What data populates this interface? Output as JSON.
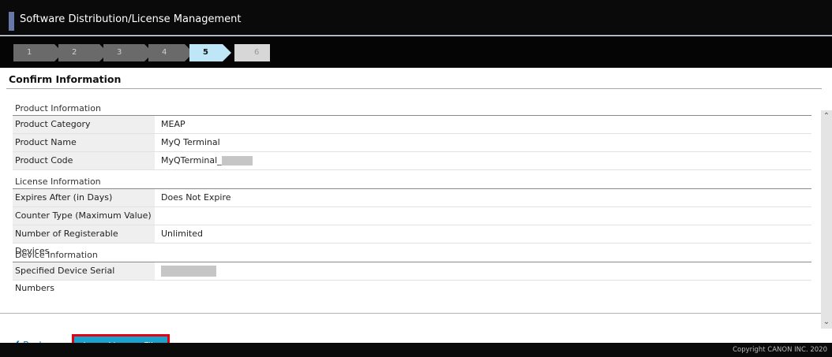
{
  "header": {
    "title": "Software Distribution/License Management"
  },
  "steps": [
    {
      "label": "1"
    },
    {
      "label": "2"
    },
    {
      "label": "3"
    },
    {
      "label": "4"
    },
    {
      "label": "5"
    },
    {
      "label": "6"
    }
  ],
  "page": {
    "section_title": "Confirm Information"
  },
  "product": {
    "heading": "Product Information",
    "category_label": "Product Category",
    "category_value": "MEAP",
    "name_label": "Product Name",
    "name_value": "MyQ Terminal",
    "code_label": "Product Code",
    "code_value": "MyQTerminal_"
  },
  "license": {
    "heading": "License Information",
    "expires_label": "Expires After (in Days)",
    "expires_value": "Does Not Expire",
    "counter_label": "Counter Type (Maximum Value)",
    "counter_value": "",
    "devices_label": "Number of Registerable Devices",
    "devices_value": "Unlimited"
  },
  "device": {
    "heading": "Device Information",
    "serials_label": "Specified Device Serial Numbers"
  },
  "buttons": {
    "back": "Back",
    "issue": "Issue License File"
  },
  "footer": {
    "copyright": "Copyright CANON INC. 2020"
  },
  "colors": {
    "accent": "#1aa3cc",
    "highlight": "#e60012",
    "current_step": "#bfe6f6"
  }
}
